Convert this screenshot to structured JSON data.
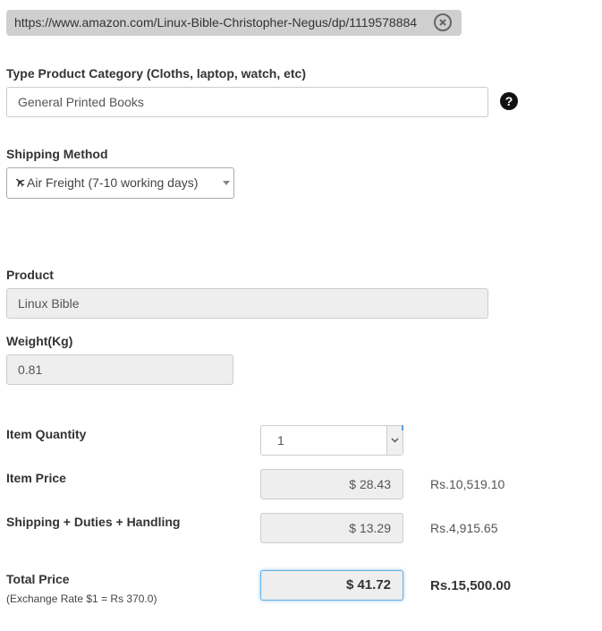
{
  "url_bar": {
    "value": "https://www.amazon.com/Linux-Bible-Christopher-Negus/dp/1119578884",
    "clear_icon": "circle-x-icon"
  },
  "category": {
    "label": "Type Product Category (Cloths, laptop, watch, etc)",
    "value": "General Printed Books",
    "help_icon": "question-circle-icon",
    "help_glyph": "?"
  },
  "shipping": {
    "label": "Shipping Method",
    "selected": "Air Freight (7-10 working days)",
    "icon": "airplane-icon"
  },
  "product": {
    "label": "Product",
    "value": "Linux Bible"
  },
  "weight": {
    "label": "Weight(Kg)",
    "value": "0.81"
  },
  "quantity": {
    "label": "Item Quantity",
    "value": "1"
  },
  "item_price": {
    "label": "Item Price",
    "usd": "$ 28.43",
    "lkr": "Rs.10,519.10"
  },
  "shipping_cost": {
    "label": "Shipping + Duties + Handling",
    "usd": "$ 13.29",
    "lkr": "Rs.4,915.65"
  },
  "total": {
    "label": "Total Price",
    "exchange_note": "(Exchange Rate $1 = Rs 370.0)",
    "usd": "$ 41.72",
    "lkr": "Rs.15,500.00"
  },
  "colors": {
    "readonly_bg": "#eeeeee",
    "focus_border": "#66afe9",
    "url_bar_bg": "#cfcfcf"
  }
}
